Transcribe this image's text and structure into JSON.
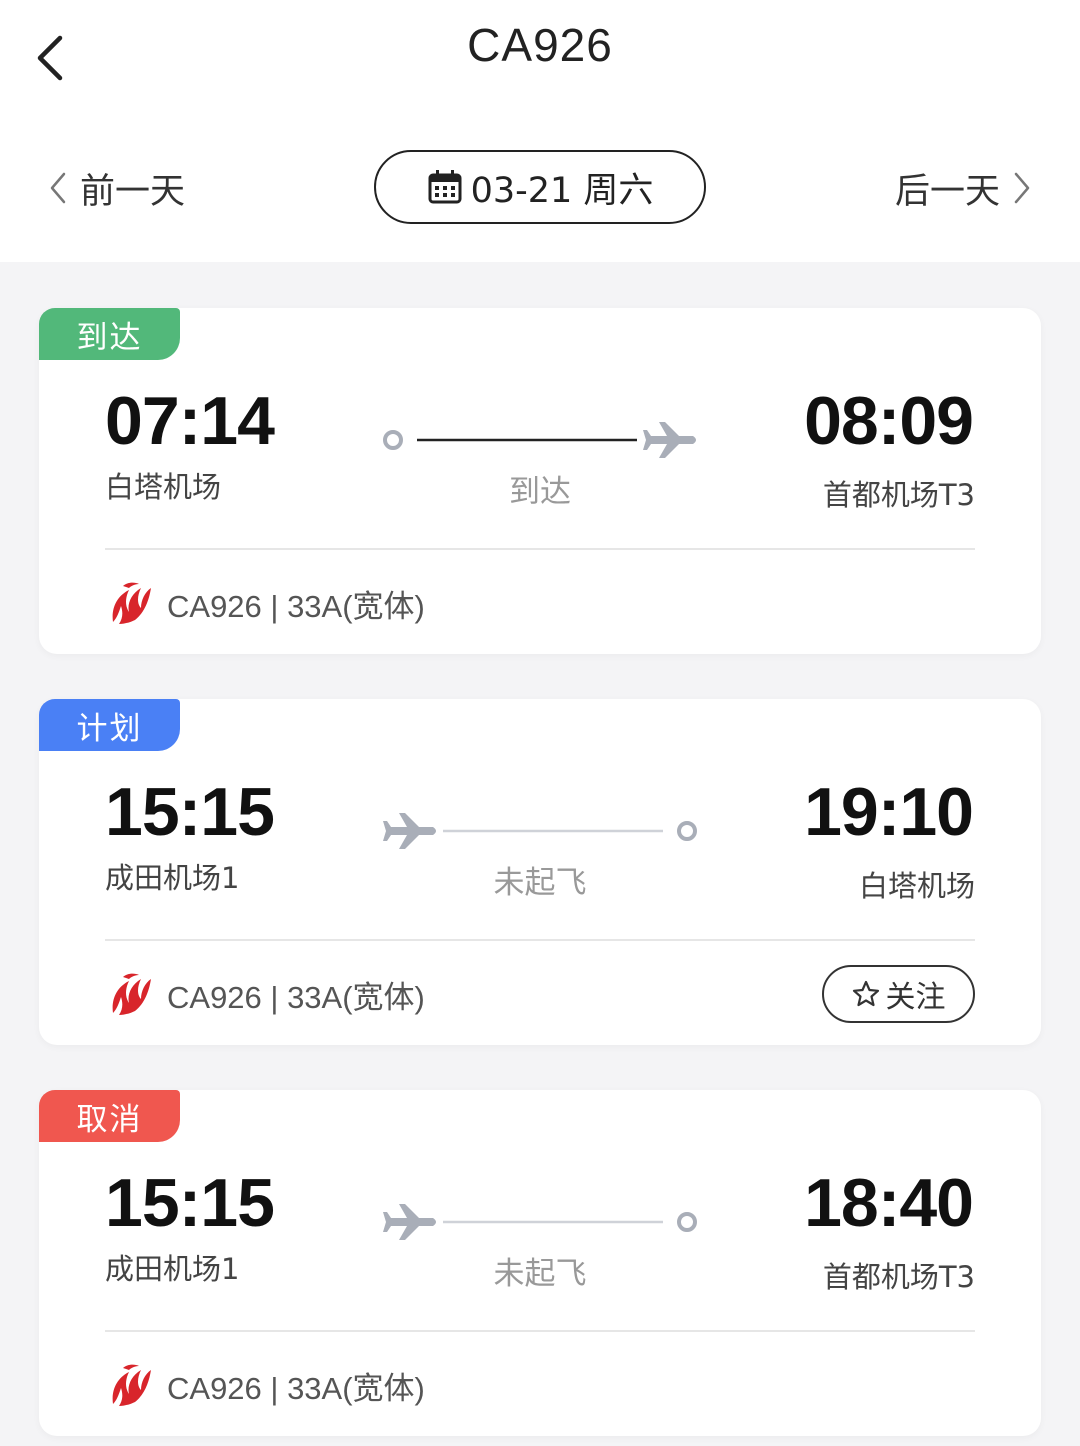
{
  "header": {
    "title": "CA926",
    "back_icon": "chevron-left-icon",
    "prev_day_label": "前一天",
    "next_day_label": "后一天",
    "date_label": "03-21 周六",
    "calendar_icon": "calendar-icon"
  },
  "colors": {
    "arrived": "#52b87a",
    "planned": "#4a80f5",
    "cancelled": "#f0574f",
    "route_gray": "#a9aeb8"
  },
  "flights": [
    {
      "status": "到达",
      "dep_time": "07:14",
      "dep_airport": "白塔机场",
      "arr_time": "08:09",
      "arr_airport": "首都机场T3",
      "route_label": "到达",
      "flight_info": "CA926 | 33A(宽体)",
      "has_follow": false
    },
    {
      "status": "计划",
      "dep_time": "15:15",
      "dep_airport": "成田机场1",
      "arr_time": "19:10",
      "arr_airport": "白塔机场",
      "route_label": "未起飞",
      "flight_info": "CA926 | 33A(宽体)",
      "has_follow": true,
      "follow_label": "关注"
    },
    {
      "status": "取消",
      "dep_time": "15:15",
      "dep_airport": "成田机场1",
      "arr_time": "18:40",
      "arr_airport": "首都机场T3",
      "route_label": "未起飞",
      "flight_info": "CA926 | 33A(宽体)",
      "has_follow": false
    }
  ]
}
